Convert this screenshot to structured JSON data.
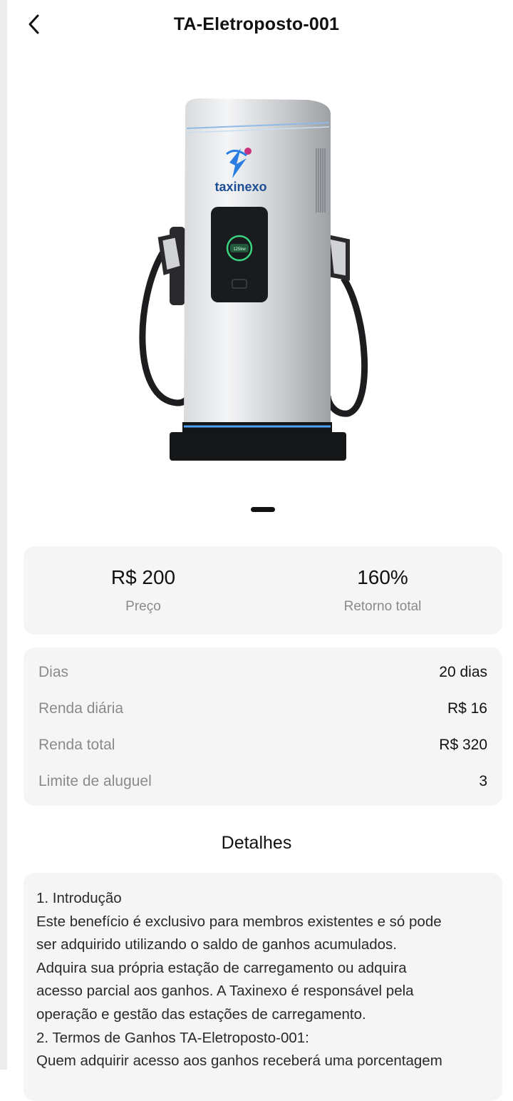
{
  "header": {
    "title": "TA-Eletroposto-001",
    "back_icon": "chevron-left-icon"
  },
  "product": {
    "brand": "taxinexo",
    "screen_text": "125kw",
    "image_count": 1,
    "active_image": 1
  },
  "stats": {
    "price_value": "R$ 200",
    "price_label": "Preço",
    "return_value": "160%",
    "return_label": "Retorno total"
  },
  "info": {
    "rows": [
      {
        "label": "Dias",
        "value": "20 dias"
      },
      {
        "label": "Renda diária",
        "value": "R$ 16"
      },
      {
        "label": "Renda total",
        "value": "R$ 320"
      },
      {
        "label": "Limite de aluguel",
        "value": "3"
      }
    ]
  },
  "details": {
    "title": "Detalhes",
    "lines": [
      "1. Introdução",
      "Este benefício é exclusivo para membros existentes e só pode",
      "ser adquirido utilizando o saldo de ganhos acumulados.",
      "Adquira sua própria estação de carregamento ou adquira",
      "acesso parcial aos ganhos. A Taxinexo é responsável pela",
      "operação e gestão das estações de carregamento.",
      "2. Termos de Ganhos TA-Eletroposto-001:",
      "Quem adquirir acesso aos ganhos receberá uma porcentagem"
    ]
  }
}
